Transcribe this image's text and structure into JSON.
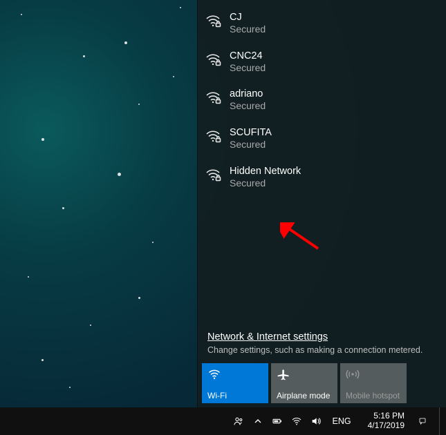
{
  "networks": [
    {
      "name": "CJ",
      "status": "Secured"
    },
    {
      "name": "CNC24",
      "status": "Secured"
    },
    {
      "name": "adriano",
      "status": "Secured"
    },
    {
      "name": "SCUFITA",
      "status": "Secured"
    },
    {
      "name": "Hidden Network",
      "status": "Secured"
    }
  ],
  "settings": {
    "link": "Network & Internet settings",
    "desc": "Change settings, such as making a connection metered."
  },
  "tiles": {
    "wifi": "Wi-Fi",
    "airplane": "Airplane mode",
    "hotspot": "Mobile hotspot"
  },
  "tray": {
    "lang": "ENG",
    "time": "5:16 PM",
    "date": "4/17/2019"
  }
}
